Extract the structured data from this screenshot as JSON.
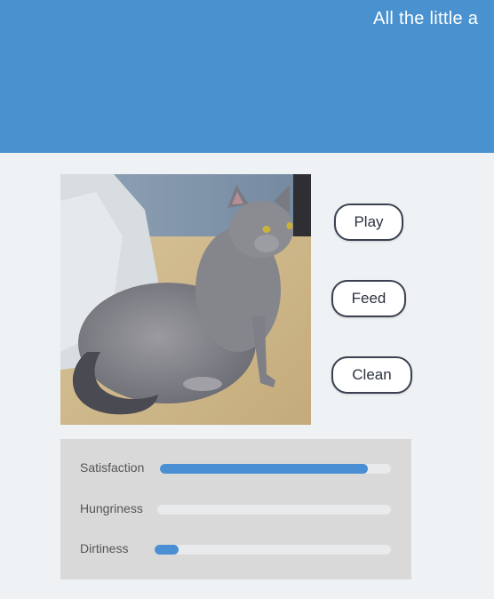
{
  "header": {
    "title": "All the little a",
    "background_color": "#4a92cf"
  },
  "pet": {
    "image_icon": "gray-cat-photo"
  },
  "actions": {
    "play_label": "Play",
    "feed_label": "Feed",
    "clean_label": "Clean"
  },
  "stats": [
    {
      "label": "Satisfaction",
      "level": 0.9
    },
    {
      "label": "Hungriness",
      "level": 0.0
    },
    {
      "label": "Dirtiness",
      "level": 0.1
    }
  ],
  "colors": {
    "accent": "#4a8fd4",
    "panel": "#d9d9d9",
    "page_background": "#eef2f5"
  }
}
